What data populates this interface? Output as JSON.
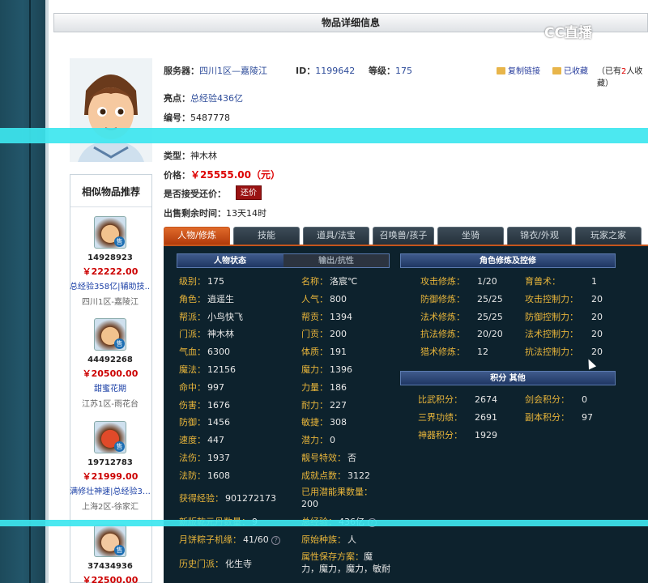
{
  "page_title": "物品详细信息",
  "watermark": "CC直播",
  "item": {
    "server_label": "服务器：",
    "server": "四川1区—嘉陵江",
    "id_label": "ID：",
    "id": "1199642",
    "level_label": "等级：",
    "level": "175",
    "highlight_label": "亮点：",
    "highlight": "总经验436亿",
    "serial_label": "编号：",
    "serial": "5487778",
    "type_label": "类型：",
    "type": "神木林",
    "price_label": "价格：",
    "price": "￥25555.00（元）",
    "bargain_label": "是否接受还价：",
    "bargain_button": "还价",
    "time_label": "出售剩余时间：",
    "time": "13天14时"
  },
  "tools": {
    "copy_link": "复制链接",
    "favorited": "已收藏",
    "fav_prefix": "（已有",
    "fav_count": "2",
    "fav_suffix": "人收藏）"
  },
  "sidebar": {
    "title": "相似物品推荐",
    "sold_badge": "售",
    "items": [
      {
        "id": "14928923",
        "price": "￥22222.00",
        "name": "总经验358亿|辅助技…",
        "server": "四川1区-嘉陵江"
      },
      {
        "id": "44492268",
        "price": "￥20500.00",
        "name": "甜蜜花期",
        "server": "江苏1区-雨花台"
      },
      {
        "id": "19712783",
        "price": "￥21999.00",
        "name": "满修壮神速|总经验3…",
        "server": "上海2区-徐家汇"
      },
      {
        "id": "37434936",
        "price": "￥22500.00",
        "name": "",
        "server": ""
      }
    ]
  },
  "tabs": [
    "人物/修炼",
    "技能",
    "道具/法宝",
    "召唤兽/孩子",
    "坐骑",
    "锦衣/外观",
    "玩家之家"
  ],
  "status_panel": {
    "tab_active": "人物状态",
    "tab_inactive": "输出/抗性",
    "left_col": [
      {
        "k": "级别：",
        "v": "175"
      },
      {
        "k": "角色：",
        "v": "逍遥生"
      },
      {
        "k": "帮派：",
        "v": "小鸟快飞"
      },
      {
        "k": "门派：",
        "v": "神木林"
      },
      {
        "k": "气血：",
        "v": "6300"
      },
      {
        "k": "魔法：",
        "v": "12156"
      },
      {
        "k": "命中：",
        "v": "997"
      },
      {
        "k": "伤害：",
        "v": "1676"
      },
      {
        "k": "防御：",
        "v": "1456"
      },
      {
        "k": "速度：",
        "v": "447"
      },
      {
        "k": "法伤：",
        "v": "1937"
      },
      {
        "k": "法防：",
        "v": "1608"
      }
    ],
    "right_col": [
      {
        "k": "名称：",
        "v": "洛宸℃"
      },
      {
        "k": "人气：",
        "v": "800"
      },
      {
        "k": "帮贡：",
        "v": "1394"
      },
      {
        "k": "门贡：",
        "v": "200"
      },
      {
        "k": "体质：",
        "v": "191"
      },
      {
        "k": "魔力：",
        "v": "1396"
      },
      {
        "k": "力量：",
        "v": "186"
      },
      {
        "k": "耐力：",
        "v": "227"
      },
      {
        "k": "敏捷：",
        "v": "308"
      },
      {
        "k": "潜力：",
        "v": "0"
      },
      {
        "k": "靓号特效：",
        "v": "否"
      },
      {
        "k": "成就点数：",
        "v": "3122"
      }
    ],
    "exp_label": "获得经验：",
    "exp_value": "901272173",
    "potential_label": "已用潜能果数量：",
    "potential_value": "200",
    "newtrans_label": "新版乾元丹数量：",
    "newtrans_value": "9",
    "total_exp_label": "总经验：",
    "total_exp_value": "436亿",
    "moon_label": "月饼粽子机缘：",
    "moon_value": "41/60",
    "race_label": "原始种族：",
    "race_value": "人",
    "history_label": "历史门派：",
    "history_value": "化生寺",
    "attr_label": "属性保存方案：",
    "attr_value1": "魔",
    "attr_value2": "力，魔力，魔力，敏耐"
  },
  "cultivation": {
    "title": "角色修炼及控修",
    "rows": [
      {
        "k1": "攻击修炼：",
        "v1": "1/20",
        "k2": "育兽术：",
        "v2": "1"
      },
      {
        "k1": "防御修炼：",
        "v1": "25/25",
        "k2": "攻击控制力：",
        "v2": "20"
      },
      {
        "k1": "法术修炼：",
        "v1": "25/25",
        "k2": "防御控制力：",
        "v2": "20"
      },
      {
        "k1": "抗法修炼：",
        "v1": "20/20",
        "k2": "法术控制力：",
        "v2": "20"
      },
      {
        "k1": "猎术修炼：",
        "v1": "12",
        "k2": "抗法控制力：",
        "v2": "20"
      }
    ]
  },
  "points": {
    "title": "积分 其他",
    "rows": [
      {
        "k1": "比武积分：",
        "v1": "2674",
        "k2": "剑会积分：",
        "v2": "0"
      },
      {
        "k1": "三界功绩：",
        "v1": "2691",
        "k2": "副本积分：",
        "v2": "97"
      },
      {
        "k1": "神器积分：",
        "v1": "1929",
        "k2": "",
        "v2": ""
      }
    ]
  }
}
